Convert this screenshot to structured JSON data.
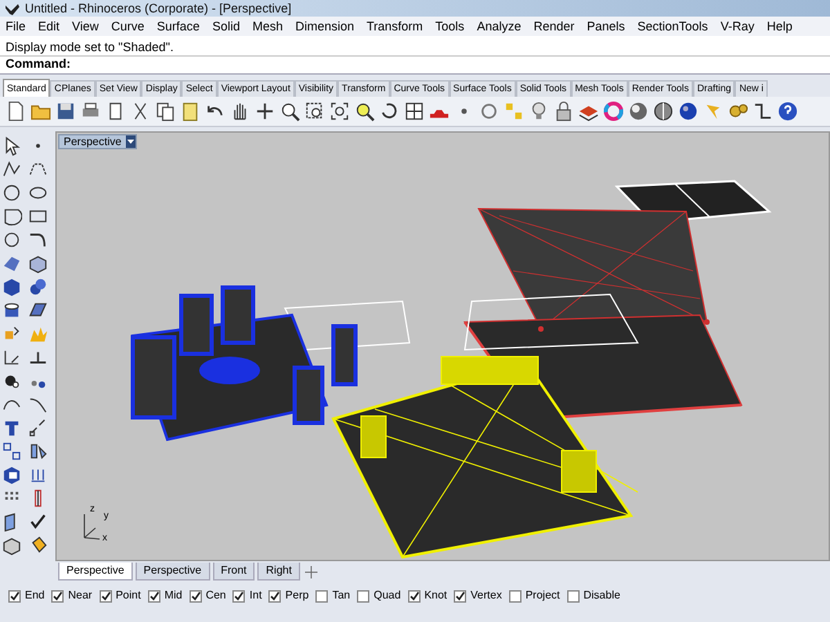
{
  "window": {
    "title": "Untitled - Rhinoceros (Corporate) - [Perspective]"
  },
  "menu": [
    "File",
    "Edit",
    "View",
    "Curve",
    "Surface",
    "Solid",
    "Mesh",
    "Dimension",
    "Transform",
    "Tools",
    "Analyze",
    "Render",
    "Panels",
    "SectionTools",
    "V-Ray",
    "Help"
  ],
  "command_history": "Display mode set to \"Shaded\".",
  "command_prompt": "Command:",
  "toolbar_tabs": [
    {
      "label": "Standard",
      "selected": true
    },
    {
      "label": "CPlanes",
      "selected": false
    },
    {
      "label": "Set View",
      "selected": false
    },
    {
      "label": "Display",
      "selected": false
    },
    {
      "label": "Select",
      "selected": false
    },
    {
      "label": "Viewport Layout",
      "selected": false
    },
    {
      "label": "Visibility",
      "selected": false
    },
    {
      "label": "Transform",
      "selected": false
    },
    {
      "label": "Curve Tools",
      "selected": false
    },
    {
      "label": "Surface Tools",
      "selected": false
    },
    {
      "label": "Solid Tools",
      "selected": false
    },
    {
      "label": "Mesh Tools",
      "selected": false
    },
    {
      "label": "Render Tools",
      "selected": false
    },
    {
      "label": "Drafting",
      "selected": false
    },
    {
      "label": "New i",
      "selected": false
    }
  ],
  "viewport": {
    "title": "Perspective",
    "axes": [
      "z",
      "y",
      "x"
    ]
  },
  "viewport_tabs": [
    {
      "label": "Perspective",
      "selected": true
    },
    {
      "label": "Perspective",
      "selected": false
    },
    {
      "label": "Front",
      "selected": false
    },
    {
      "label": "Right",
      "selected": false
    }
  ],
  "osnaps": [
    {
      "label": "End",
      "checked": true
    },
    {
      "label": "Near",
      "checked": true
    },
    {
      "label": "Point",
      "checked": true
    },
    {
      "label": "Mid",
      "checked": true
    },
    {
      "label": "Cen",
      "checked": true
    },
    {
      "label": "Int",
      "checked": true
    },
    {
      "label": "Perp",
      "checked": true
    },
    {
      "label": "Tan",
      "checked": false
    },
    {
      "label": "Quad",
      "checked": false
    },
    {
      "label": "Knot",
      "checked": true
    },
    {
      "label": "Vertex",
      "checked": true
    },
    {
      "label": "Project",
      "checked": false
    },
    {
      "label": "Disable",
      "checked": false
    }
  ]
}
